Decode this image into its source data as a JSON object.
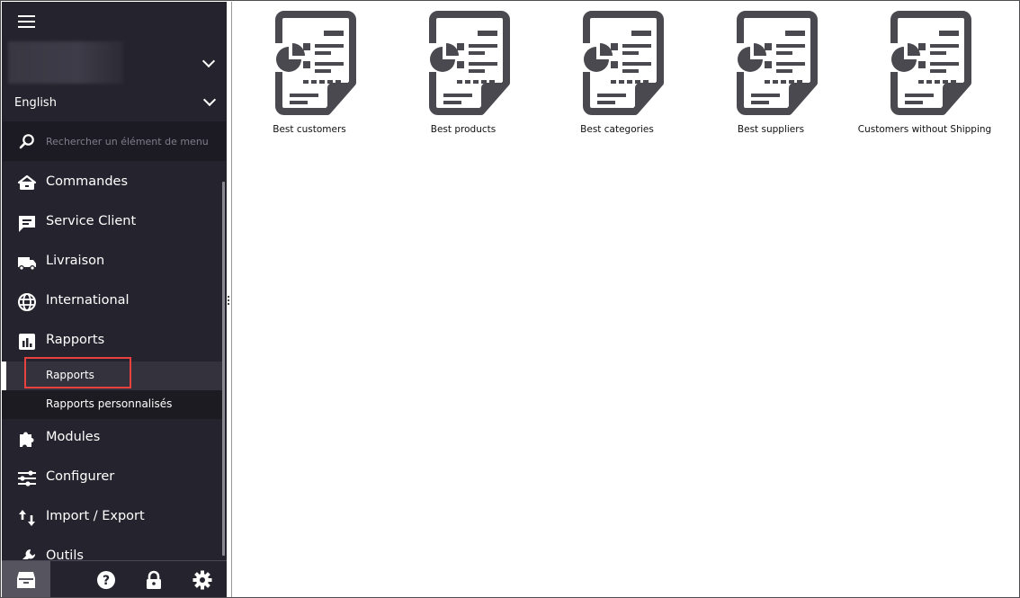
{
  "sidebar": {
    "shop_selector": {
      "value": ""
    },
    "language": {
      "value": "English"
    },
    "search": {
      "placeholder": "Rechercher un élément de menu"
    },
    "menu": [
      {
        "id": "commandes",
        "label": "Commandes",
        "icon": "basket-icon"
      },
      {
        "id": "service-client",
        "label": "Service Client",
        "icon": "chat-icon"
      },
      {
        "id": "livraison",
        "label": "Livraison",
        "icon": "truck-icon"
      },
      {
        "id": "international",
        "label": "International",
        "icon": "globe-icon"
      },
      {
        "id": "rapports",
        "label": "Rapports",
        "icon": "bar-chart-icon",
        "children": [
          {
            "id": "rapports-sub",
            "label": "Rapports",
            "active": true
          },
          {
            "id": "rapports-personnalises",
            "label": "Rapports personnalisés",
            "active": false
          }
        ]
      },
      {
        "id": "modules",
        "label": "Modules",
        "icon": "puzzle-icon"
      },
      {
        "id": "configurer",
        "label": "Configurer",
        "icon": "sliders-icon"
      },
      {
        "id": "import-export",
        "label": "Import / Export",
        "icon": "arrows-updown-icon"
      },
      {
        "id": "outils",
        "label": "Outils",
        "icon": "wrench-icon"
      }
    ],
    "bottom_bar": [
      {
        "id": "inbox",
        "icon": "inbox-icon",
        "active": true
      },
      {
        "id": "help",
        "icon": "help-icon",
        "active": false
      },
      {
        "id": "lock",
        "icon": "lock-icon",
        "active": false
      },
      {
        "id": "settings",
        "icon": "gear-icon",
        "active": false
      }
    ]
  },
  "reports": [
    {
      "label": "Best customers",
      "icon": "report-document-icon"
    },
    {
      "label": "Best products",
      "icon": "report-document-icon"
    },
    {
      "label": "Best categories",
      "icon": "report-document-icon"
    },
    {
      "label": "Best suppliers",
      "icon": "report-document-icon"
    },
    {
      "label": "Customers without Shipping",
      "icon": "report-document-icon"
    }
  ],
  "colors": {
    "sidebar_bg": "#25242e",
    "active_sub_bg": "#33323d",
    "icon_gray": "#4a4950",
    "annotation_red": "#e8413f"
  }
}
